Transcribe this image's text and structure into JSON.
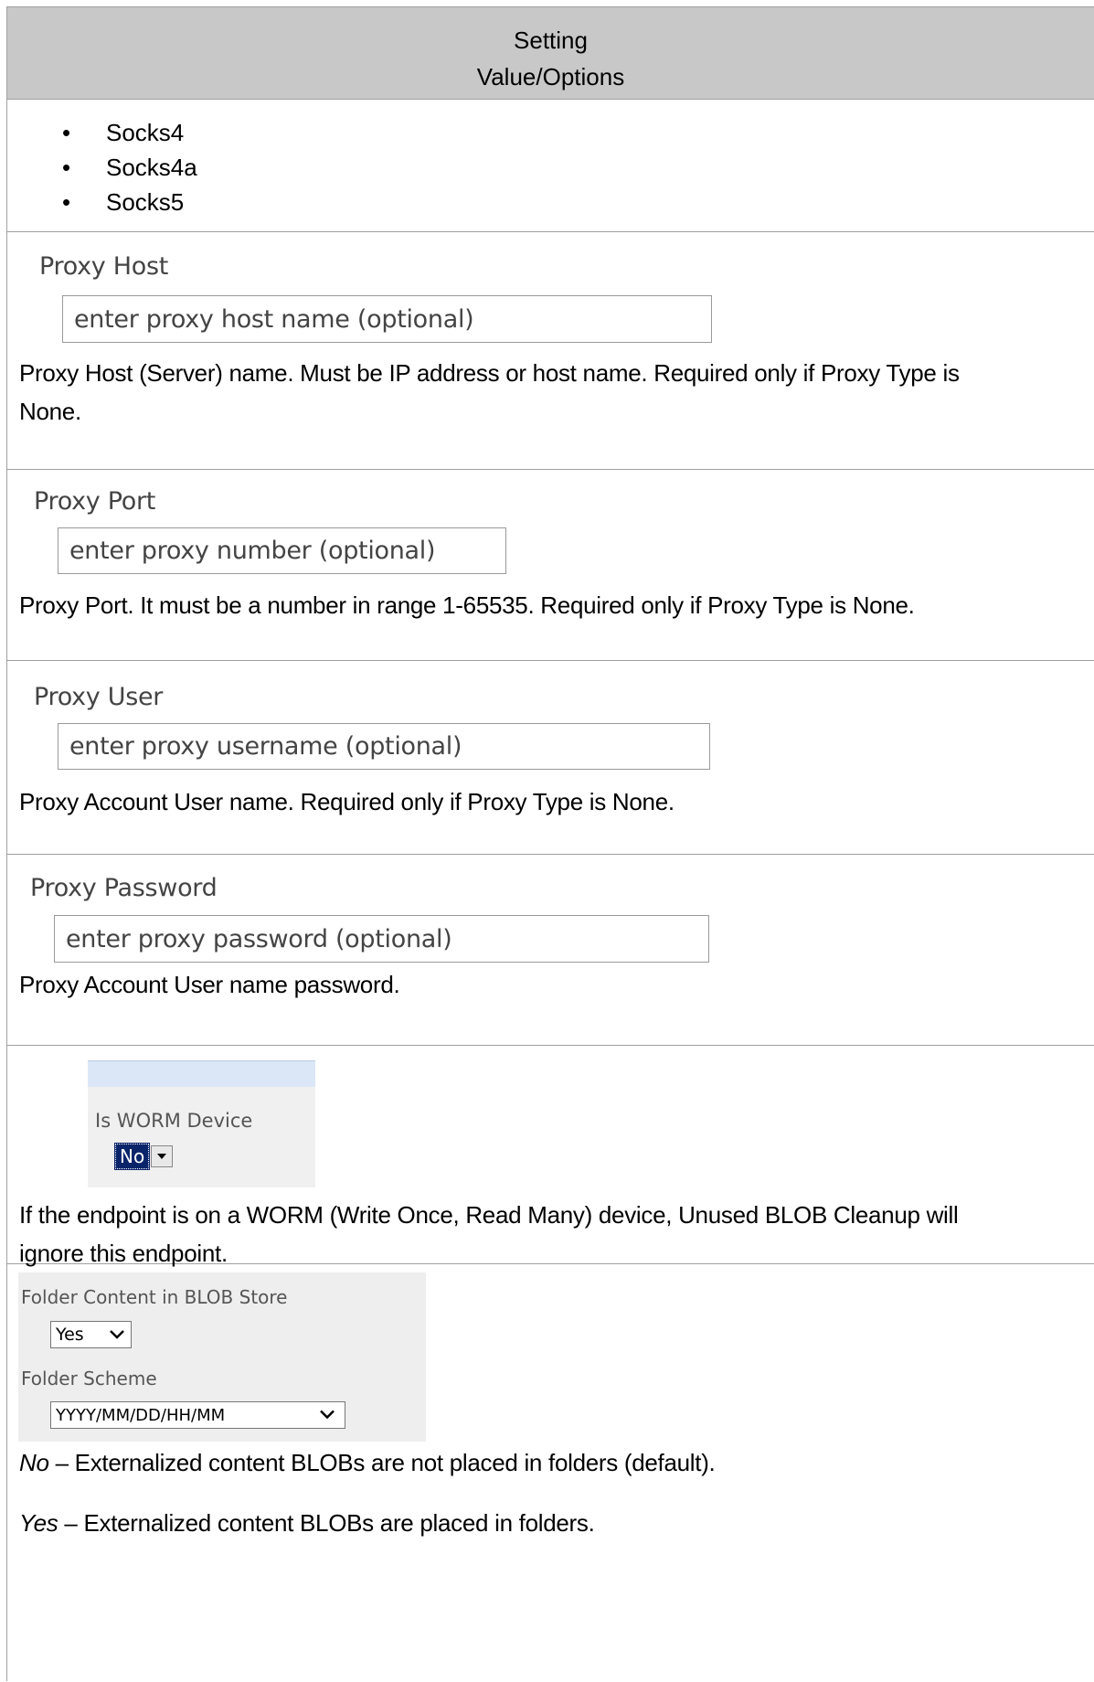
{
  "header": {
    "line1": "Setting",
    "line2": "Value/Options"
  },
  "proxy_types": {
    "items": [
      "Socks4",
      "Socks4a",
      "Socks5"
    ]
  },
  "proxy_host": {
    "label": "Proxy Host",
    "placeholder": "enter proxy host name (optional)",
    "description_line1": "Proxy Host (Server) name. Must be IP address or host name. Required only if Proxy Type is",
    "description_line2": "None."
  },
  "proxy_port": {
    "label": "Proxy Port",
    "placeholder": "enter proxy number (optional)",
    "description": "Proxy Port. It must be a number in range 1-65535. Required only if Proxy Type is None."
  },
  "proxy_user": {
    "label": "Proxy User",
    "placeholder": "enter proxy username (optional)",
    "description": "Proxy Account User name. Required only if Proxy Type is None."
  },
  "proxy_password": {
    "label": "Proxy Password",
    "placeholder": "enter proxy password (optional)",
    "description": "Proxy Account User name password."
  },
  "worm": {
    "label": "Is WORM Device",
    "value": "No",
    "description_line1": "If the endpoint is on a WORM (Write Once, Read Many) device, Unused BLOB Cleanup will",
    "description_line2": "ignore this endpoint."
  },
  "folder": {
    "content_label": "Folder Content in BLOB Store",
    "content_value": "Yes",
    "scheme_label": "Folder Scheme",
    "scheme_value": "YYYY/MM/DD/HH/MM",
    "no_term": "No",
    "no_text": " – Externalized content BLOBs are not placed in folders (default).",
    "yes_term": "Yes",
    "yes_text": " – Externalized content BLOBs are placed in folders."
  },
  "icons": {
    "dropdown": "chevron-down-icon",
    "spin": "triangle-down-icon"
  }
}
